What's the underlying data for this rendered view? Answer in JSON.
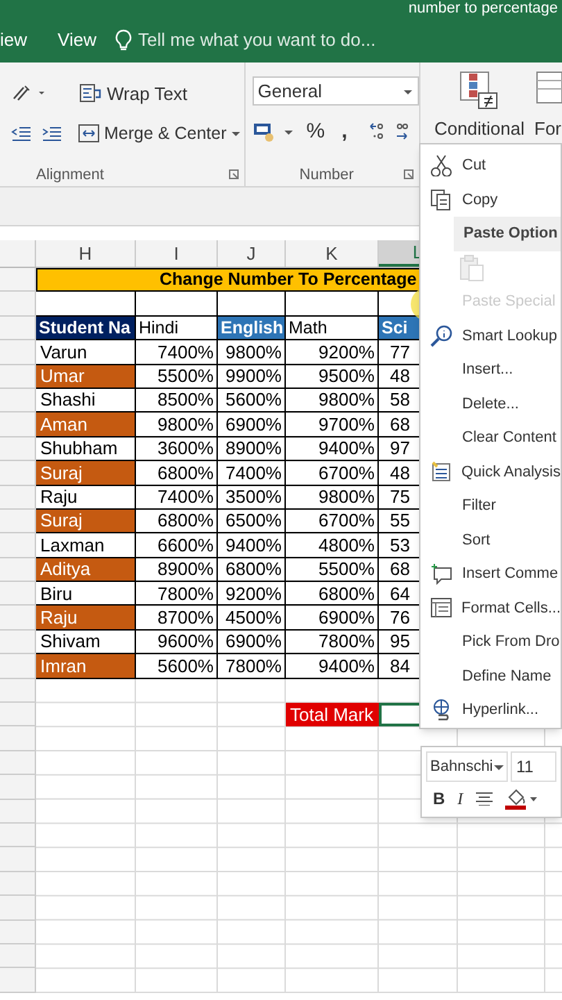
{
  "title_bar": {
    "title": "number to percentage"
  },
  "ribbon_tabs": [
    {
      "label": "iew",
      "selected": false
    },
    {
      "label": "View",
      "selected": false
    }
  ],
  "tell_me": {
    "placeholder": "Tell me what you want to do..."
  },
  "ribbon": {
    "wrap_text": "Wrap Text",
    "merge_center": "Merge & Center",
    "number_format": "General",
    "percent": "%",
    "comma": ",",
    "conditional": "Conditional",
    "format_partial": "For",
    "groups": [
      "Alignment",
      "Number"
    ]
  },
  "column_headers": [
    {
      "label": "H",
      "selected": false
    },
    {
      "label": "I",
      "selected": false
    },
    {
      "label": "J",
      "selected": false
    },
    {
      "label": "K",
      "selected": false
    },
    {
      "label": "L",
      "selected": true
    }
  ],
  "sheet": {
    "title": "Change Number To Percentage",
    "headers": [
      {
        "label": "Student Na",
        "highlighted": true
      },
      {
        "label": "Hindi",
        "highlighted": false
      },
      {
        "label": "English",
        "highlighted": true
      },
      {
        "label": "Math",
        "highlighted": false
      },
      {
        "label": "Sci",
        "highlighted": true
      }
    ],
    "rows": [
      {
        "name": "Varun",
        "highlighted": false,
        "scores": [
          "7400%",
          "9800%",
          "9200%"
        ],
        "sci": "77"
      },
      {
        "name": "Umar",
        "highlighted": true,
        "scores": [
          "5500%",
          "9900%",
          "9500%"
        ],
        "sci": "48"
      },
      {
        "name": "Shashi",
        "highlighted": false,
        "scores": [
          "8500%",
          "5600%",
          "9800%"
        ],
        "sci": "58"
      },
      {
        "name": "Aman",
        "highlighted": true,
        "scores": [
          "9800%",
          "6900%",
          "9700%"
        ],
        "sci": "68"
      },
      {
        "name": "Shubham",
        "highlighted": false,
        "scores": [
          "3600%",
          "8900%",
          "9400%"
        ],
        "sci": "97"
      },
      {
        "name": "Suraj",
        "highlighted": true,
        "scores": [
          "6800%",
          "7400%",
          "6700%"
        ],
        "sci": "48"
      },
      {
        "name": "Raju",
        "highlighted": false,
        "scores": [
          "7400%",
          "3500%",
          "9800%"
        ],
        "sci": "75"
      },
      {
        "name": "Suraj",
        "highlighted": true,
        "scores": [
          "6800%",
          "6500%",
          "6700%"
        ],
        "sci": "55"
      },
      {
        "name": "Laxman",
        "highlighted": false,
        "scores": [
          "6600%",
          "9400%",
          "4800%"
        ],
        "sci": "53"
      },
      {
        "name": "Aditya",
        "highlighted": true,
        "scores": [
          "8900%",
          "6800%",
          "5500%"
        ],
        "sci": "68"
      },
      {
        "name": "Biru",
        "highlighted": false,
        "scores": [
          "7800%",
          "9200%",
          "6800%"
        ],
        "sci": "64"
      },
      {
        "name": "Raju",
        "highlighted": true,
        "scores": [
          "8700%",
          "4500%",
          "6900%"
        ],
        "sci": "76"
      },
      {
        "name": "Shivam",
        "highlighted": false,
        "scores": [
          "9600%",
          "6900%",
          "7800%"
        ],
        "sci": "95"
      },
      {
        "name": "Imran",
        "highlighted": true,
        "scores": [
          "5600%",
          "7800%",
          "9400%"
        ],
        "sci": "84"
      }
    ],
    "total_label": "Total Mark"
  },
  "context_menu": [
    {
      "kind": "cut",
      "label": "Cut",
      "disabled": false
    },
    {
      "kind": "copy",
      "label": "Copy",
      "disabled": false
    },
    {
      "kind": "heading",
      "label": "Paste Option",
      "disabled": false
    },
    {
      "kind": "paste",
      "disabled": true
    },
    {
      "kind": "item",
      "label": "Paste Special",
      "disabled": true
    },
    {
      "kind": "lookup",
      "label": "Smart Lookup",
      "disabled": false
    },
    {
      "kind": "item",
      "label": "Insert...",
      "disabled": false
    },
    {
      "kind": "item",
      "label": "Delete...",
      "disabled": false
    },
    {
      "kind": "item",
      "label": "Clear Content",
      "disabled": false
    },
    {
      "kind": "analysis",
      "label": "Quick Analysis",
      "disabled": false
    },
    {
      "kind": "item",
      "label": "Filter",
      "disabled": false
    },
    {
      "kind": "item",
      "label": "Sort",
      "disabled": false
    },
    {
      "kind": "comment",
      "label": "Insert Comme",
      "disabled": false
    },
    {
      "kind": "format",
      "label": "Format Cells...",
      "disabled": false
    },
    {
      "kind": "item",
      "label": "Pick From Dro",
      "disabled": false
    },
    {
      "kind": "item",
      "label": "Define Name",
      "disabled": false
    },
    {
      "kind": "link",
      "label": "Hyperlink...",
      "disabled": false
    }
  ],
  "mini_toolbar": {
    "font": "Bahnschi",
    "size": "11",
    "bold": "B",
    "italic": "I"
  }
}
